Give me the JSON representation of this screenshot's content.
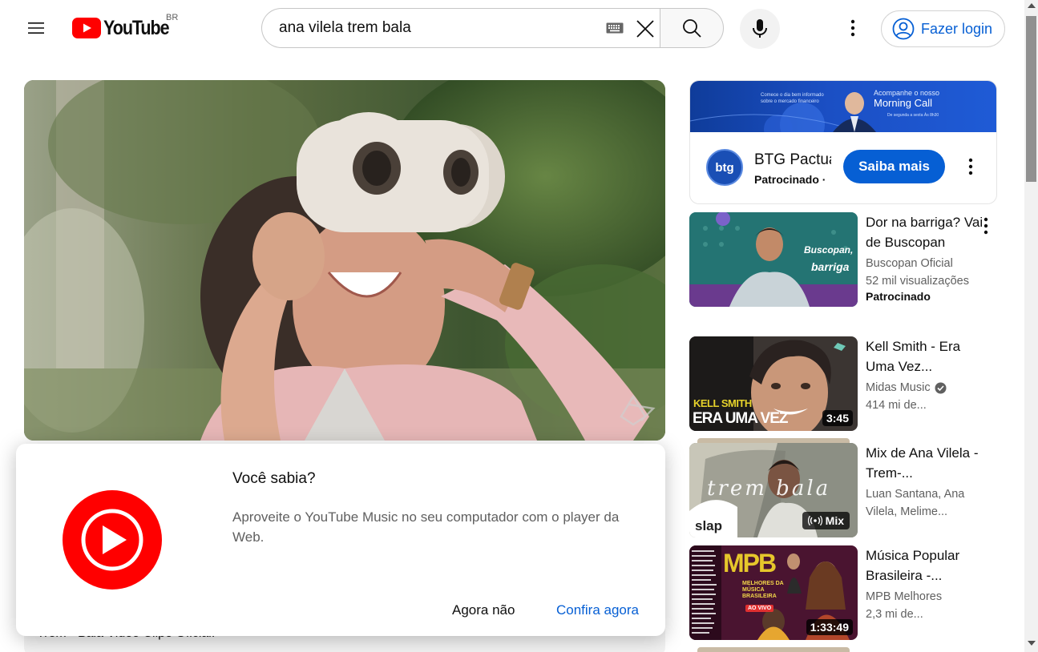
{
  "header": {
    "logo_text": "YouTube",
    "region": "BR",
    "search_value": "ana vilela trem bala",
    "login_label": "Fazer login"
  },
  "player": {
    "below_text": "Trem - Bala Video Clipe Oficial."
  },
  "promo": {
    "title": "Você sabia?",
    "body": "Aproveite o YouTube Music no seu computador com o player da Web.",
    "cancel_label": "Agora não",
    "ok_label": "Confira agora"
  },
  "ad": {
    "banner_left": "Comece o dia bem informado sobre o mercado financeiro",
    "banner_right_1": "Acompanhe o nosso",
    "banner_right_2": "Morning Call",
    "banner_right_3": "De segunda a sexta Às 8h30",
    "logo_text": "btg",
    "name": "BTG Pactual",
    "sponsored": "Patrocinado ·",
    "cta": "Saiba mais"
  },
  "recommendations": [
    {
      "title": "Dor na barriga? Vai de Buscopan",
      "channel": "Buscopan Oficial",
      "views": "52 mil visualizações",
      "sponsored": "Patrocinado",
      "thumb_text_1": "Buscopan,",
      "thumb_text_2": "barriga"
    },
    {
      "title": "Kell Smith - Era Uma Vez...",
      "channel": "Midas Music",
      "views": "414 mi de...",
      "duration": "3:45",
      "thumb_text_1": "KELL SMITH",
      "thumb_text_2": "ERA UMA VEZ"
    },
    {
      "title": "Mix de Ana Vilela - Trem-...",
      "channel": "Luan Santana, Ana Vilela, Melime...",
      "badge": "Mix",
      "thumb_text_1": "trem bala",
      "thumb_text_2": "slap"
    },
    {
      "title": "Música Popular Brasileira -...",
      "channel": "MPB Melhores",
      "views": "2,3 mi de...",
      "duration": "1:33:49",
      "thumb_text_1": "MPB",
      "thumb_text_2": "MELHORES DA MÚSICA BRASILEIRA",
      "thumb_text_3": "AO VIVO"
    }
  ],
  "colors": {
    "brand_red": "#ff0000",
    "link_blue": "#065fd4"
  }
}
